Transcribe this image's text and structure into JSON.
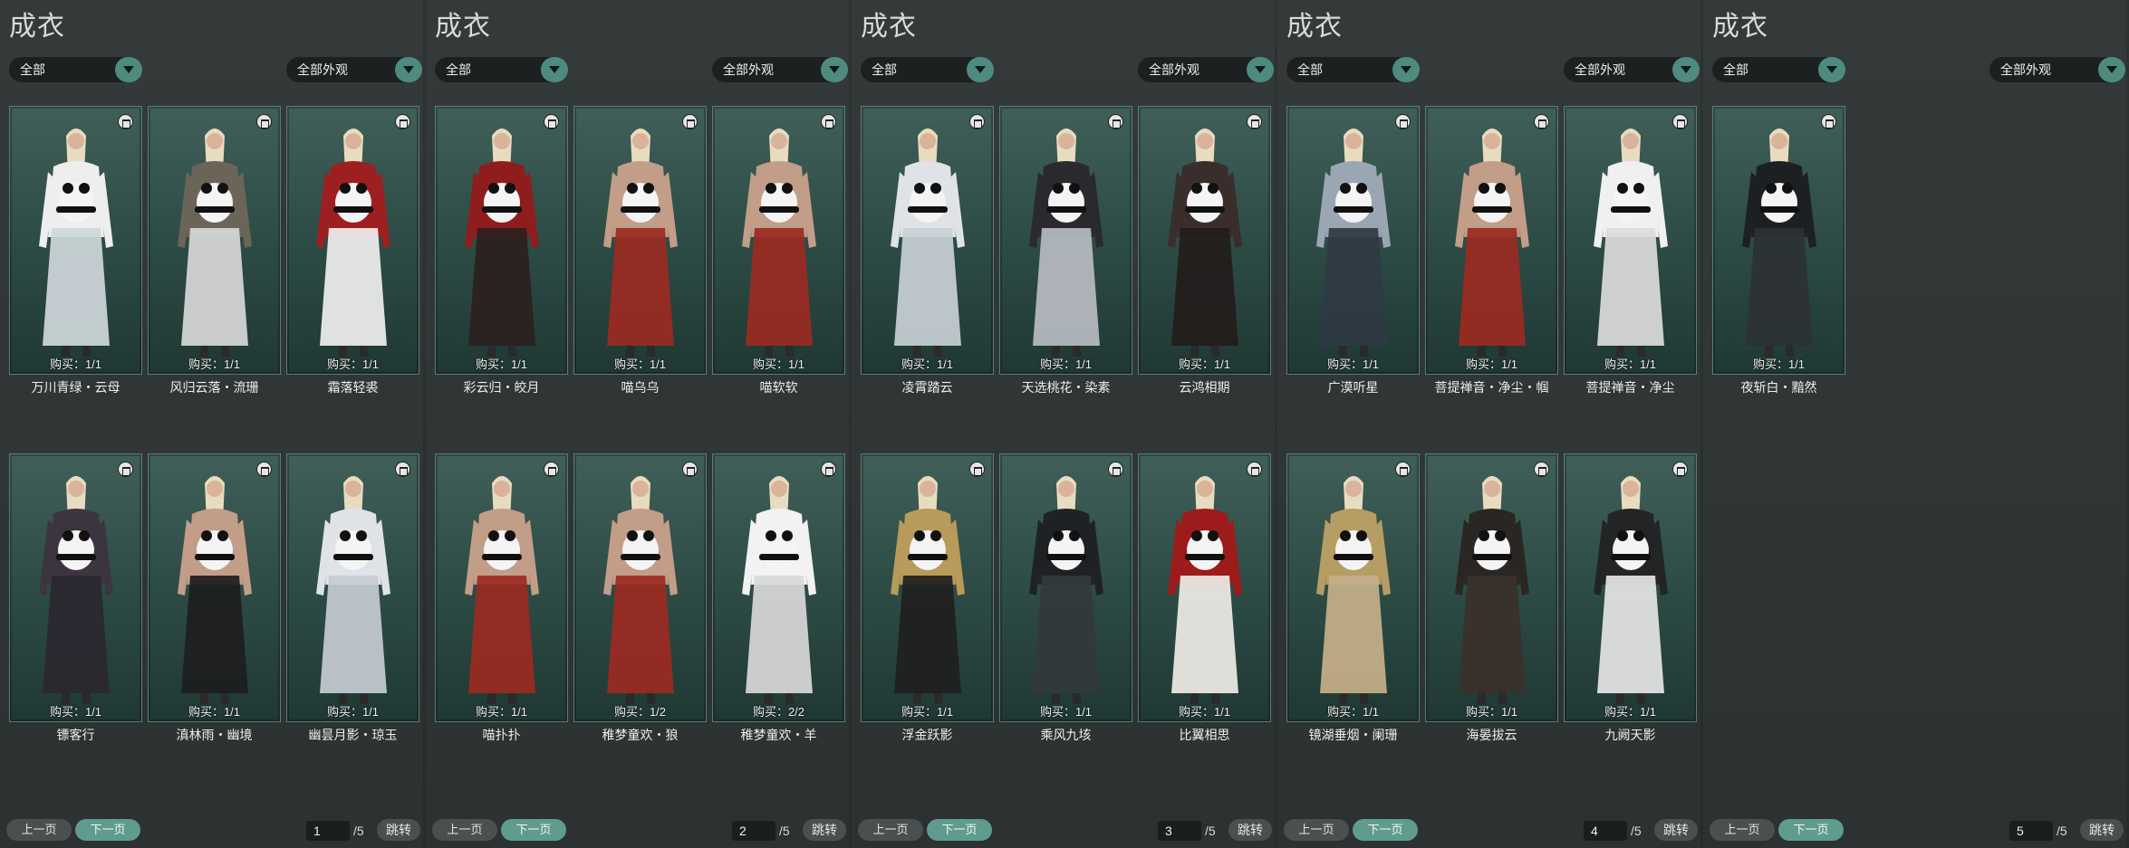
{
  "panels": [
    {
      "title": "成衣",
      "filter_category": "全部",
      "filter_appearance": "全部外观",
      "cards": [
        {
          "name": "万川青绿・云母",
          "buy": "购买：1/1",
          "icon": "trash-icon",
          "colors": [
            "#eeeeee",
            "#cfd8dc"
          ]
        },
        {
          "name": "风归云落・流珊",
          "buy": "购买：1/1",
          "icon": "trash-icon",
          "colors": [
            "#6b6458",
            "#d8d8d8"
          ]
        },
        {
          "name": "霜落轻裘",
          "buy": "购买：1/1",
          "icon": "trash-icon",
          "colors": [
            "#9e1f1f",
            "#f0f0f0"
          ]
        },
        {
          "name": "镖客行",
          "buy": "购买：1/1",
          "icon": "trash-icon",
          "colors": [
            "#3c3540",
            "#2b2730"
          ]
        },
        {
          "name": "滇林雨・幽境",
          "buy": "购买：1/1",
          "icon": "trash-icon",
          "colors": [
            "#c29d88",
            "#1d1d1f"
          ]
        },
        {
          "name": "幽昙月影・琼玉",
          "buy": "购买：1/1",
          "icon": "trash-icon",
          "colors": [
            "#dfe3e8",
            "#c6ccd3"
          ]
        }
      ],
      "pagination": {
        "prev": "上一页",
        "next": "下一页",
        "page": "1",
        "total": "/5",
        "jump": "跳转"
      }
    },
    {
      "title": "成衣",
      "filter_category": "全部",
      "filter_appearance": "全部外观",
      "cards": [
        {
          "name": "彩云归・皎月",
          "buy": "购买：1/1",
          "icon": "trash-icon",
          "colors": [
            "#8f1d1d",
            "#2b2020"
          ]
        },
        {
          "name": "喵乌乌",
          "buy": "购买：1/1",
          "icon": "trash-icon",
          "colors": [
            "#c29d88",
            "#9b2a22"
          ]
        },
        {
          "name": "喵软软",
          "buy": "购买：1/1",
          "icon": "trash-icon",
          "colors": [
            "#c29d88",
            "#9b2a22"
          ]
        },
        {
          "name": "喵扑扑",
          "buy": "购买：1/1",
          "icon": "trash-icon",
          "colors": [
            "#c29d88",
            "#9b2a22"
          ]
        },
        {
          "name": "稚梦童欢・狼",
          "buy": "购买：1/2",
          "icon": "trash-icon",
          "colors": [
            "#c29d88",
            "#9b2a22"
          ]
        },
        {
          "name": "稚梦童欢・羊",
          "buy": "购买：2/2",
          "icon": "trash-icon",
          "colors": [
            "#f2f2f2",
            "#d9d9d9"
          ]
        }
      ],
      "pagination": {
        "prev": "上一页",
        "next": "下一页",
        "page": "2",
        "total": "/5",
        "jump": "跳转"
      }
    },
    {
      "title": "成衣",
      "filter_category": "全部",
      "filter_appearance": "全部外观",
      "cards": [
        {
          "name": "凌霄踏云",
          "buy": "购买：1/1",
          "icon": "trash-icon",
          "colors": [
            "#dfe3e6",
            "#c9d0d6"
          ]
        },
        {
          "name": "天选桃花・染素",
          "buy": "购买：1/1",
          "icon": "trash-icon",
          "colors": [
            "#2a2a2e",
            "#b7bcc2"
          ]
        },
        {
          "name": "云鸿相期",
          "buy": "购买：1/1",
          "icon": "trash-icon",
          "colors": [
            "#3a2e2c",
            "#231c1b"
          ]
        },
        {
          "name": "浮金跃影",
          "buy": "购买：1/1",
          "icon": "trash-icon",
          "colors": [
            "#b89a5a",
            "#1f1f1f"
          ]
        },
        {
          "name": "乘风九垓",
          "buy": "购买：1/1",
          "icon": "trash-icon",
          "colors": [
            "#1f2224",
            "#33383b"
          ]
        },
        {
          "name": "比翼相思",
          "buy": "购买：1/1",
          "icon": "trash-icon",
          "colors": [
            "#9d1b1b",
            "#f0ece6"
          ]
        }
      ],
      "pagination": {
        "prev": "上一页",
        "next": "下一页",
        "page": "3",
        "total": "/5",
        "jump": "跳转"
      }
    },
    {
      "title": "成衣",
      "filter_category": "全部",
      "filter_appearance": "全部外观",
      "cards": [
        {
          "name": "广漠听星",
          "buy": "购买：1/1",
          "icon": "restore-icon",
          "colors": [
            "#9aa7b3",
            "#2f3a44"
          ]
        },
        {
          "name": "菩提禅音・净尘・帼",
          "buy": "购买：1/1",
          "icon": "trash-icon",
          "colors": [
            "#c29d88",
            "#9b2a22"
          ]
        },
        {
          "name": "菩提禅音・净尘",
          "buy": "购买：1/1",
          "icon": "trash-icon",
          "colors": [
            "#f0f0f0",
            "#dcdcdc"
          ]
        },
        {
          "name": "镜湖垂烟・阑珊",
          "buy": "购买：1/1",
          "icon": "restore-icon",
          "colors": [
            "#b59d63",
            "#c7b08a"
          ]
        },
        {
          "name": "海晏拔云",
          "buy": "购买：1/1",
          "icon": "trash-icon",
          "colors": [
            "#2a2624",
            "#3b302a"
          ]
        },
        {
          "name": "九阙天影",
          "buy": "购买：1/1",
          "icon": "trash-icon",
          "colors": [
            "#222426",
            "#e6e6e6"
          ]
        }
      ],
      "pagination": {
        "prev": "上一页",
        "next": "下一页",
        "page": "4",
        "total": "/5",
        "jump": "跳转"
      }
    },
    {
      "title": "成衣",
      "filter_category": "全部",
      "filter_appearance": "全部外观",
      "cards": [
        {
          "name": "夜斩白・黯然",
          "buy": "购买：1/1",
          "icon": "trash-icon",
          "colors": [
            "#1d2022",
            "#2c3135"
          ]
        }
      ],
      "pagination": {
        "prev": "上一页",
        "next": "下一页",
        "page": "5",
        "total": "/5",
        "jump": "跳转"
      }
    }
  ]
}
